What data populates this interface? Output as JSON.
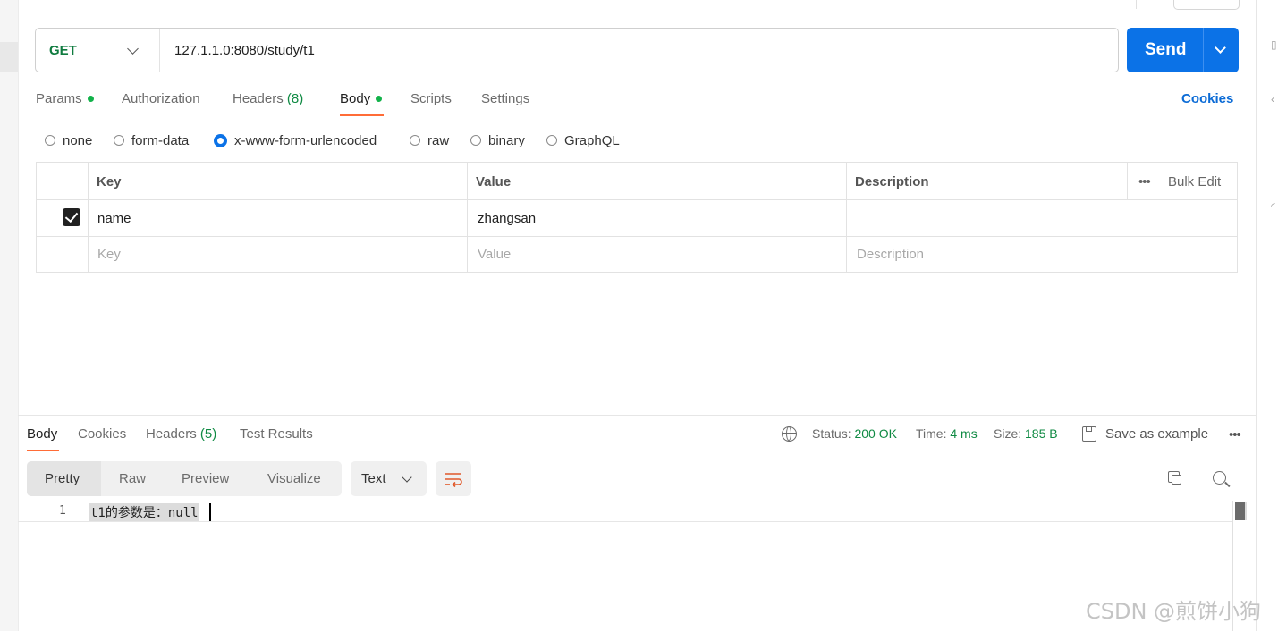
{
  "request": {
    "method": "GET",
    "url": "127.1.1.0:8080/study/t1",
    "send_label": "Send"
  },
  "request_tabs": [
    {
      "label": "Params",
      "dot": true
    },
    {
      "label": "Authorization"
    },
    {
      "label": "Headers",
      "count": "(8)"
    },
    {
      "label": "Body",
      "dot": true,
      "active": true
    },
    {
      "label": "Scripts"
    },
    {
      "label": "Settings"
    }
  ],
  "cookies_link": "Cookies",
  "body_types": [
    {
      "label": "none",
      "selected": false
    },
    {
      "label": "form-data",
      "selected": false
    },
    {
      "label": "x-www-form-urlencoded",
      "selected": true
    },
    {
      "label": "raw",
      "selected": false
    },
    {
      "label": "binary",
      "selected": false
    },
    {
      "label": "GraphQL",
      "selected": false
    }
  ],
  "params_table": {
    "headers": {
      "key": "Key",
      "value": "Value",
      "description": "Description"
    },
    "bulk_edit": "Bulk Edit",
    "rows": [
      {
        "checked": true,
        "key": "name",
        "value": "zhangsan",
        "description": ""
      }
    ],
    "placeholders": {
      "key": "Key",
      "value": "Value",
      "description": "Description"
    }
  },
  "response": {
    "tabs": [
      {
        "label": "Body",
        "active": true
      },
      {
        "label": "Cookies"
      },
      {
        "label": "Headers",
        "count": "(5)"
      },
      {
        "label": "Test Results"
      }
    ],
    "status_label": "Status:",
    "status_value": "200 OK",
    "time_label": "Time:",
    "time_value": "4 ms",
    "size_label": "Size:",
    "size_value": "185 B",
    "save_example": "Save as example",
    "view_modes": [
      "Pretty",
      "Raw",
      "Preview",
      "Visualize"
    ],
    "format": "Text",
    "lines": [
      {
        "number": "1",
        "text": "t1的参数是：null"
      }
    ]
  },
  "watermark": "CSDN @煎饼小狗",
  "colors": {
    "accent": "#ff6c37",
    "send": "#0b72e7",
    "status_green": "#0f8a43",
    "method_green": "#0f7b3f"
  }
}
